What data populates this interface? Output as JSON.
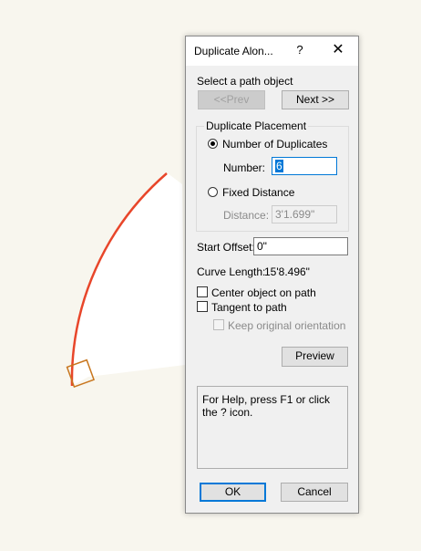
{
  "dialog": {
    "title": "Duplicate Alon...",
    "help_glyph": "?",
    "close_glyph": "✕",
    "select_prompt": "Select a path object",
    "prev_label": "<<Prev",
    "next_label": "Next >>",
    "placement_group": "Duplicate Placement",
    "number_of_duplicates_label": "Number of Duplicates",
    "number_label": "Number:",
    "number_value": "6",
    "fixed_distance_label": "Fixed Distance",
    "distance_label": "Distance:",
    "distance_value": "3'1.699\"",
    "start_offset_label": "Start Offset:",
    "start_offset_value": "0\"",
    "curve_length_label": "Curve Length:",
    "curve_length_value": "15'8.496\"",
    "center_on_path_label": "Center object on path",
    "tangent_label": "Tangent to path",
    "keep_orientation_label": "Keep original orientation",
    "preview_label": "Preview",
    "help_text": "For Help, press F1 or click the ? icon.",
    "ok_label": "OK",
    "cancel_label": "Cancel"
  },
  "colors": {
    "path_stroke": "#e8462a",
    "object_stroke": "#c8761e",
    "accent": "#0078d7"
  }
}
